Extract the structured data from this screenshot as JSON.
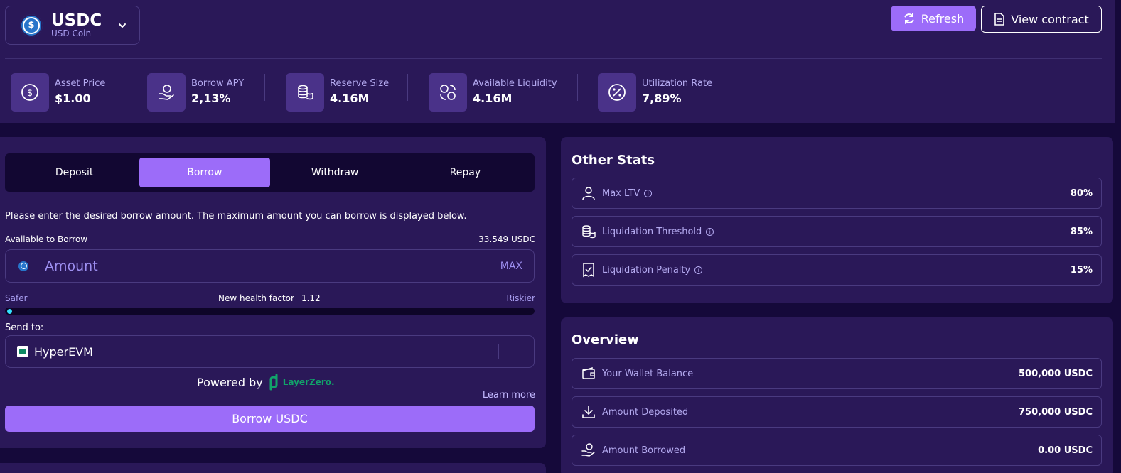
{
  "asset": {
    "symbol": "USDC",
    "name": "USD Coin"
  },
  "actions": {
    "refresh": "Refresh",
    "view_contract": "View contract"
  },
  "stats": [
    {
      "label": "Asset Price",
      "value": "$1.00",
      "icon": "dollar-icon"
    },
    {
      "label": "Borrow APY",
      "value": "2,13%",
      "icon": "hand-coin-icon"
    },
    {
      "label": "Reserve Size",
      "value": "4.16M",
      "icon": "coins-stack-icon"
    },
    {
      "label": "Available Liquidity",
      "value": "4.16M",
      "icon": "swap-coins-icon"
    },
    {
      "label": "Utilization Rate",
      "value": "7,89%",
      "icon": "percent-icon"
    }
  ],
  "tabs": {
    "deposit": "Deposit",
    "borrow": "Borrow",
    "withdraw": "Withdraw",
    "repay": "Repay",
    "active": "Borrow"
  },
  "form": {
    "instruction": "Please enter the desired borrow amount. The maximum amount you can borrow is displayed below.",
    "available_label": "Available to Borrow",
    "available_value": "33.549 USDC",
    "amount_placeholder": "Amount",
    "max_label": "MAX",
    "safer_label": "Safer",
    "riskier_label": "Riskier",
    "health_label": "New health factor",
    "health_value": "1.12",
    "send_to_label": "Send to:",
    "destination": "HyperEVM",
    "powered_by": "Powered by",
    "powered_logo_text": "LayerZero.",
    "learn_more": "Learn more",
    "submit": "Borrow USDC"
  },
  "other_stats": {
    "title": "Other Stats",
    "rows": [
      {
        "label": "Max LTV",
        "value": "80%",
        "icon": "user-icon"
      },
      {
        "label": "Liquidation Threshold",
        "value": "85%",
        "icon": "coins-stack-icon"
      },
      {
        "label": "Liquidation Penalty",
        "value": "15%",
        "icon": "receipt-icon"
      }
    ]
  },
  "overview": {
    "title": "Overview",
    "rows": [
      {
        "label": "Your Wallet Balance",
        "value": "500,000 USDC",
        "icon": "wallet-icon"
      },
      {
        "label": "Amount Deposited",
        "value": "750,000 USDC",
        "icon": "download-icon"
      },
      {
        "label": "Amount Borrowed",
        "value": "0.00 USDC",
        "icon": "hand-coin-icon"
      }
    ]
  },
  "colors": {
    "accent": "#9c6cf9",
    "panel": "#2a1858",
    "background": "#15093a",
    "health_dot": "#33e1ff",
    "layerzero": "#11a36a"
  }
}
